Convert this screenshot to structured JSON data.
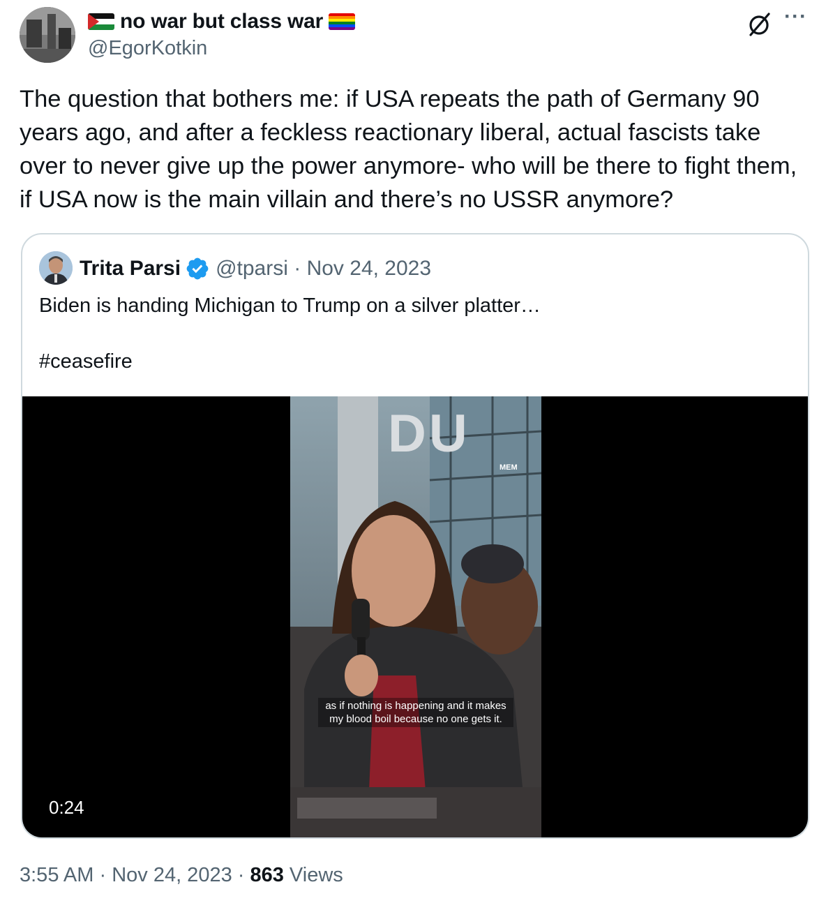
{
  "author": {
    "display_name": "no war but class war",
    "handle": "@EgorKotkin",
    "name_prefix_icon": "palestine-flag-icon",
    "name_suffix_icon": "rainbow-flag-icon"
  },
  "header_actions": {
    "grok_icon": "grok-slash-circle-icon",
    "more_icon": "more-dots-icon",
    "more_glyph": "···"
  },
  "tweet": {
    "text": "The question that bothers me: if USA repeats the path of Germany 90 years ago, and after a feckless reactionary liberal, actual fascists take over to never give up the power anymore- who will be there to fight them, if USA now is the main villain and there’s no USSR anymore?"
  },
  "quoted_tweet": {
    "name": "Trita Parsi",
    "verified_icon": "verified-badge-icon",
    "handle": "@tparsi",
    "separator": " · ",
    "date": "Nov 24, 2023",
    "text": "Biden is handing Michigan to Trump on a silver platter…\n\n#ceasefire",
    "video": {
      "duration": "0:24",
      "subtitle": "as if nothing is happening and it makes my blood boil because no one gets it.",
      "watermark": "MEM",
      "sign_letters": "DU"
    }
  },
  "footer": {
    "time": "3:55 AM",
    "separator": " · ",
    "date": "Nov 24, 2023",
    "views_count": "863",
    "views_label": " Views"
  },
  "colors": {
    "text_primary": "#0f1419",
    "text_secondary": "#536471",
    "border": "#cfd9de",
    "verified_blue": "#1d9bf0"
  }
}
